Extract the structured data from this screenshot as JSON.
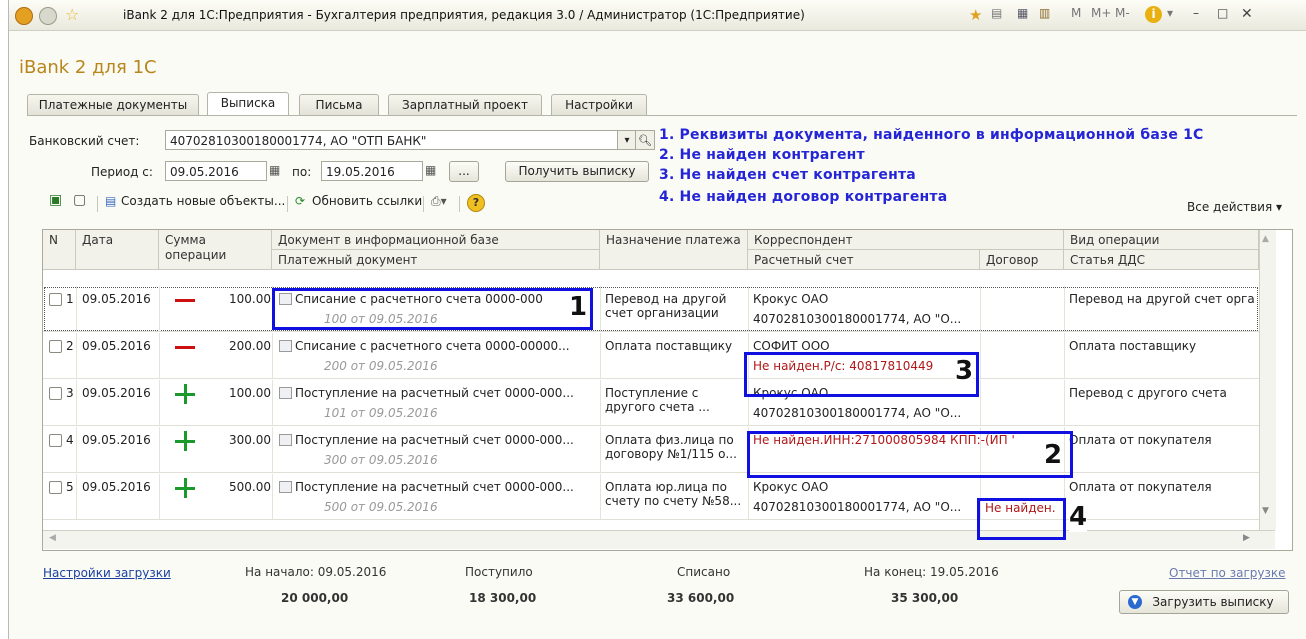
{
  "window": {
    "title": "iBank 2 для 1С:Предприятия - Бухгалтерия предприятия, редакция 3.0 / Администратор  (1С:Предприятие)",
    "buttons": [
      "M",
      "M+",
      "M-"
    ]
  },
  "app_title": "iBank 2 для 1С",
  "tabs": [
    "Платежные документы",
    "Выписка",
    "Письма",
    "Зарплатный проект",
    "Настройки"
  ],
  "form": {
    "account_label": "Банковский счет:",
    "account_value": "40702810300180001774, АО \"ОТП БАНК\"",
    "period_from_label": "Период с:",
    "period_from": "09.05.2016",
    "period_to_label": "по:",
    "period_to": "19.05.2016",
    "ellipsis": "...",
    "get_statement": "Получить выписку"
  },
  "legend": [
    "1. Реквизиты документа, найденного в информационной базе 1С",
    "2. Не найден контрагент",
    "3. Не найден счет контрагента",
    "4. Не найден договор контрагента"
  ],
  "toolbar": {
    "create_objects": "Создать новые объекты...",
    "refresh_links": "Обновить ссылки",
    "all_actions": "Все действия"
  },
  "table": {
    "headers": {
      "n": "N",
      "date": "Дата",
      "sum": "Сумма операции",
      "doc": "Документ в информационной базе",
      "doc_sub": "Платежный документ",
      "purpose": "Назначение платежа",
      "corr": "Корреспондент",
      "account": "Расчетный счет",
      "contract": "Договор",
      "op_type": "Вид операции",
      "dds": "Статья ДДС"
    },
    "rows": [
      {
        "n": "1",
        "date": "09.05.2016",
        "sign": "minus",
        "amount": "100.00",
        "doc": "Списание с расчетного счета 0000-000",
        "doc_sub": "100 от 09.05.2016",
        "purpose1": "Перевод на другой",
        "purpose2": "счет организации",
        "corr": "Крокус ОАО",
        "account": "40702810300180001774, АО \"О...",
        "contract": "",
        "op": "Перевод на другой счет орга"
      },
      {
        "n": "2",
        "date": "09.05.2016",
        "sign": "minus",
        "amount": "200.00",
        "doc": "Списание с расчетного счета 0000-00000...",
        "doc_sub": "200 от 09.05.2016",
        "purpose1": "Оплата поставщику",
        "purpose2": "",
        "corr": "СОФИТ ООО",
        "account": "Не найден.Р/с: 40817810449",
        "contract": "",
        "op": "Оплата поставщику"
      },
      {
        "n": "3",
        "date": "09.05.2016",
        "sign": "plus",
        "amount": "100.00",
        "doc": "Поступление на расчетный счет 0000-000...",
        "doc_sub": "101 от 09.05.2016",
        "purpose1": "Поступление с",
        "purpose2": "другого счета ...",
        "corr": "Крокус ОАО",
        "account": "40702810300180001774, АО \"О...",
        "contract": "",
        "op": "Перевод с другого счета"
      },
      {
        "n": "4",
        "date": "09.05.2016",
        "sign": "plus",
        "amount": "300.00",
        "doc": "Поступление на расчетный счет 0000-000...",
        "doc_sub": "300 от 09.05.2016",
        "purpose1": "Оплата физ.лица по",
        "purpose2": "договору №1/115 о...",
        "corr": "Не найден.ИНН:271000805984 КПП:-(ИП '",
        "account": "",
        "contract": "",
        "op": "Оплата от покупателя"
      },
      {
        "n": "5",
        "date": "09.05.2016",
        "sign": "plus",
        "amount": "500.00",
        "doc": "Поступление на расчетный счет 0000-000...",
        "doc_sub": "500 от 09.05.2016",
        "purpose1": "Оплата юр.лица по",
        "purpose2": "счету по счету №58...",
        "corr": "Крокус ОАО",
        "account": "40702810300180001774, АО \"О...",
        "contract": "Не найден.",
        "op": "Оплата от покупателя"
      }
    ]
  },
  "markers": [
    "1",
    "2",
    "3",
    "4"
  ],
  "footer": {
    "settings_link": "Настройки загрузки",
    "start_label": "На начало: 09.05.2016",
    "start_value": "20 000,00",
    "in_label": "Поступило",
    "in_value": "18 300,00",
    "out_label": "Списано",
    "out_value": "33 600,00",
    "end_label": "На конец: 19.05.2016",
    "end_value": "35 300,00",
    "report_link": "Отчет по загрузке",
    "load_button": "Загрузить выписку"
  }
}
